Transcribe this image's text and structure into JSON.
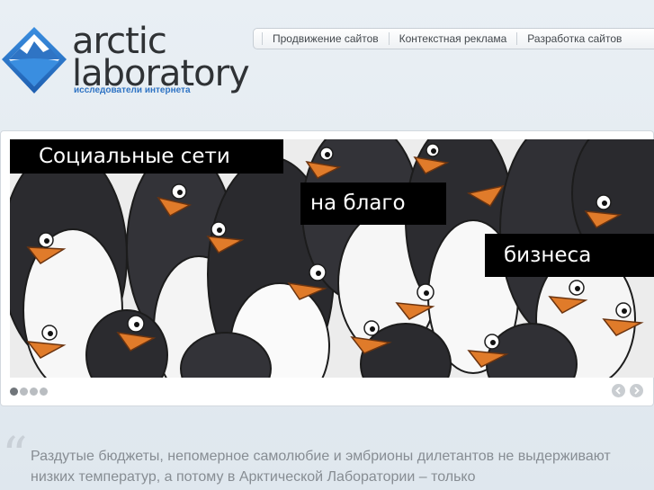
{
  "logo": {
    "word1": "arctic",
    "word2": "laboratory",
    "tagline": "исследователи интернета"
  },
  "nav": {
    "items": [
      "Продвижение сайтов",
      "Контекстная реклама",
      "Разработка сайтов"
    ]
  },
  "slider": {
    "captions": [
      "Социальные сети",
      "на благо",
      "бизнеса"
    ],
    "slide_count": 4,
    "active_slide": 1,
    "prev_icon": "chevron-left-icon",
    "next_icon": "chevron-right-icon"
  },
  "quote": {
    "mark": "“",
    "text": "Раздутые бюджеты, непомерное самолюбие и эмбрионы дилетантов не выдерживают низких температур, а потому в Арктической Лаборатории – только"
  },
  "colors": {
    "accent": "#2f74c4",
    "background": "#e4ebf1"
  }
}
